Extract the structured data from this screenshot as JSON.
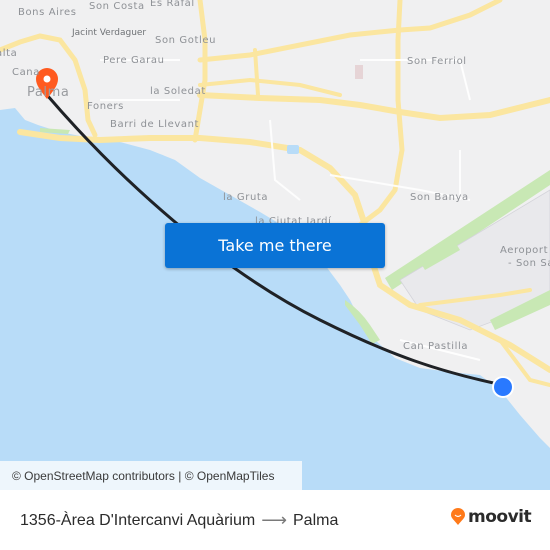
{
  "map": {
    "places": [
      {
        "name": "Bons Aires",
        "kind": "normal"
      },
      {
        "name": "Son Costa",
        "kind": "normal"
      },
      {
        "name": "Es Rafal",
        "kind": "normal"
      },
      {
        "name": "Jacint Verdaguer",
        "kind": "small"
      },
      {
        "name": "Son Gotleu",
        "kind": "normal"
      },
      {
        "name": "Pere Garau",
        "kind": "normal"
      },
      {
        "name": "alta",
        "kind": "normal"
      },
      {
        "name": "Cana",
        "kind": "normal"
      },
      {
        "name": "Palma",
        "kind": "big"
      },
      {
        "name": "la Soledat",
        "kind": "normal"
      },
      {
        "name": "Foners",
        "kind": "normal"
      },
      {
        "name": "Barri de Llevant",
        "kind": "normal"
      },
      {
        "name": "Son Ferriol",
        "kind": "normal"
      },
      {
        "name": "la Gruta",
        "kind": "normal"
      },
      {
        "name": "la Ciutat Jardí",
        "kind": "normal"
      },
      {
        "name": "Son Banya",
        "kind": "normal"
      },
      {
        "name": "Aeroport de",
        "kind": "normal"
      },
      {
        "name": "- Son Sa",
        "kind": "normal"
      },
      {
        "name": "Can Pastilla",
        "kind": "normal"
      }
    ],
    "origin_marker": {
      "label": "1356-Àrea D'Intercanvi Aquàrium",
      "color": "#2979ff"
    },
    "destination_marker": {
      "label": "Palma",
      "color": "#ff5a1f"
    },
    "route_color": "#1f2226",
    "water_color": "#b8dcf8",
    "road_color": "#fbe6a0",
    "green_color": "#c8e8b4"
  },
  "cta": {
    "label": "Take me there",
    "color": "#0a73d6"
  },
  "attribution": "© OpenStreetMap contributors | © OpenMapTiles",
  "footer": {
    "origin": "1356-Àrea D'Intercanvi Aquàrium",
    "arrow": "⟶",
    "destination": "Palma",
    "brand": "moovit",
    "brand_color": "#ff7a1a"
  }
}
